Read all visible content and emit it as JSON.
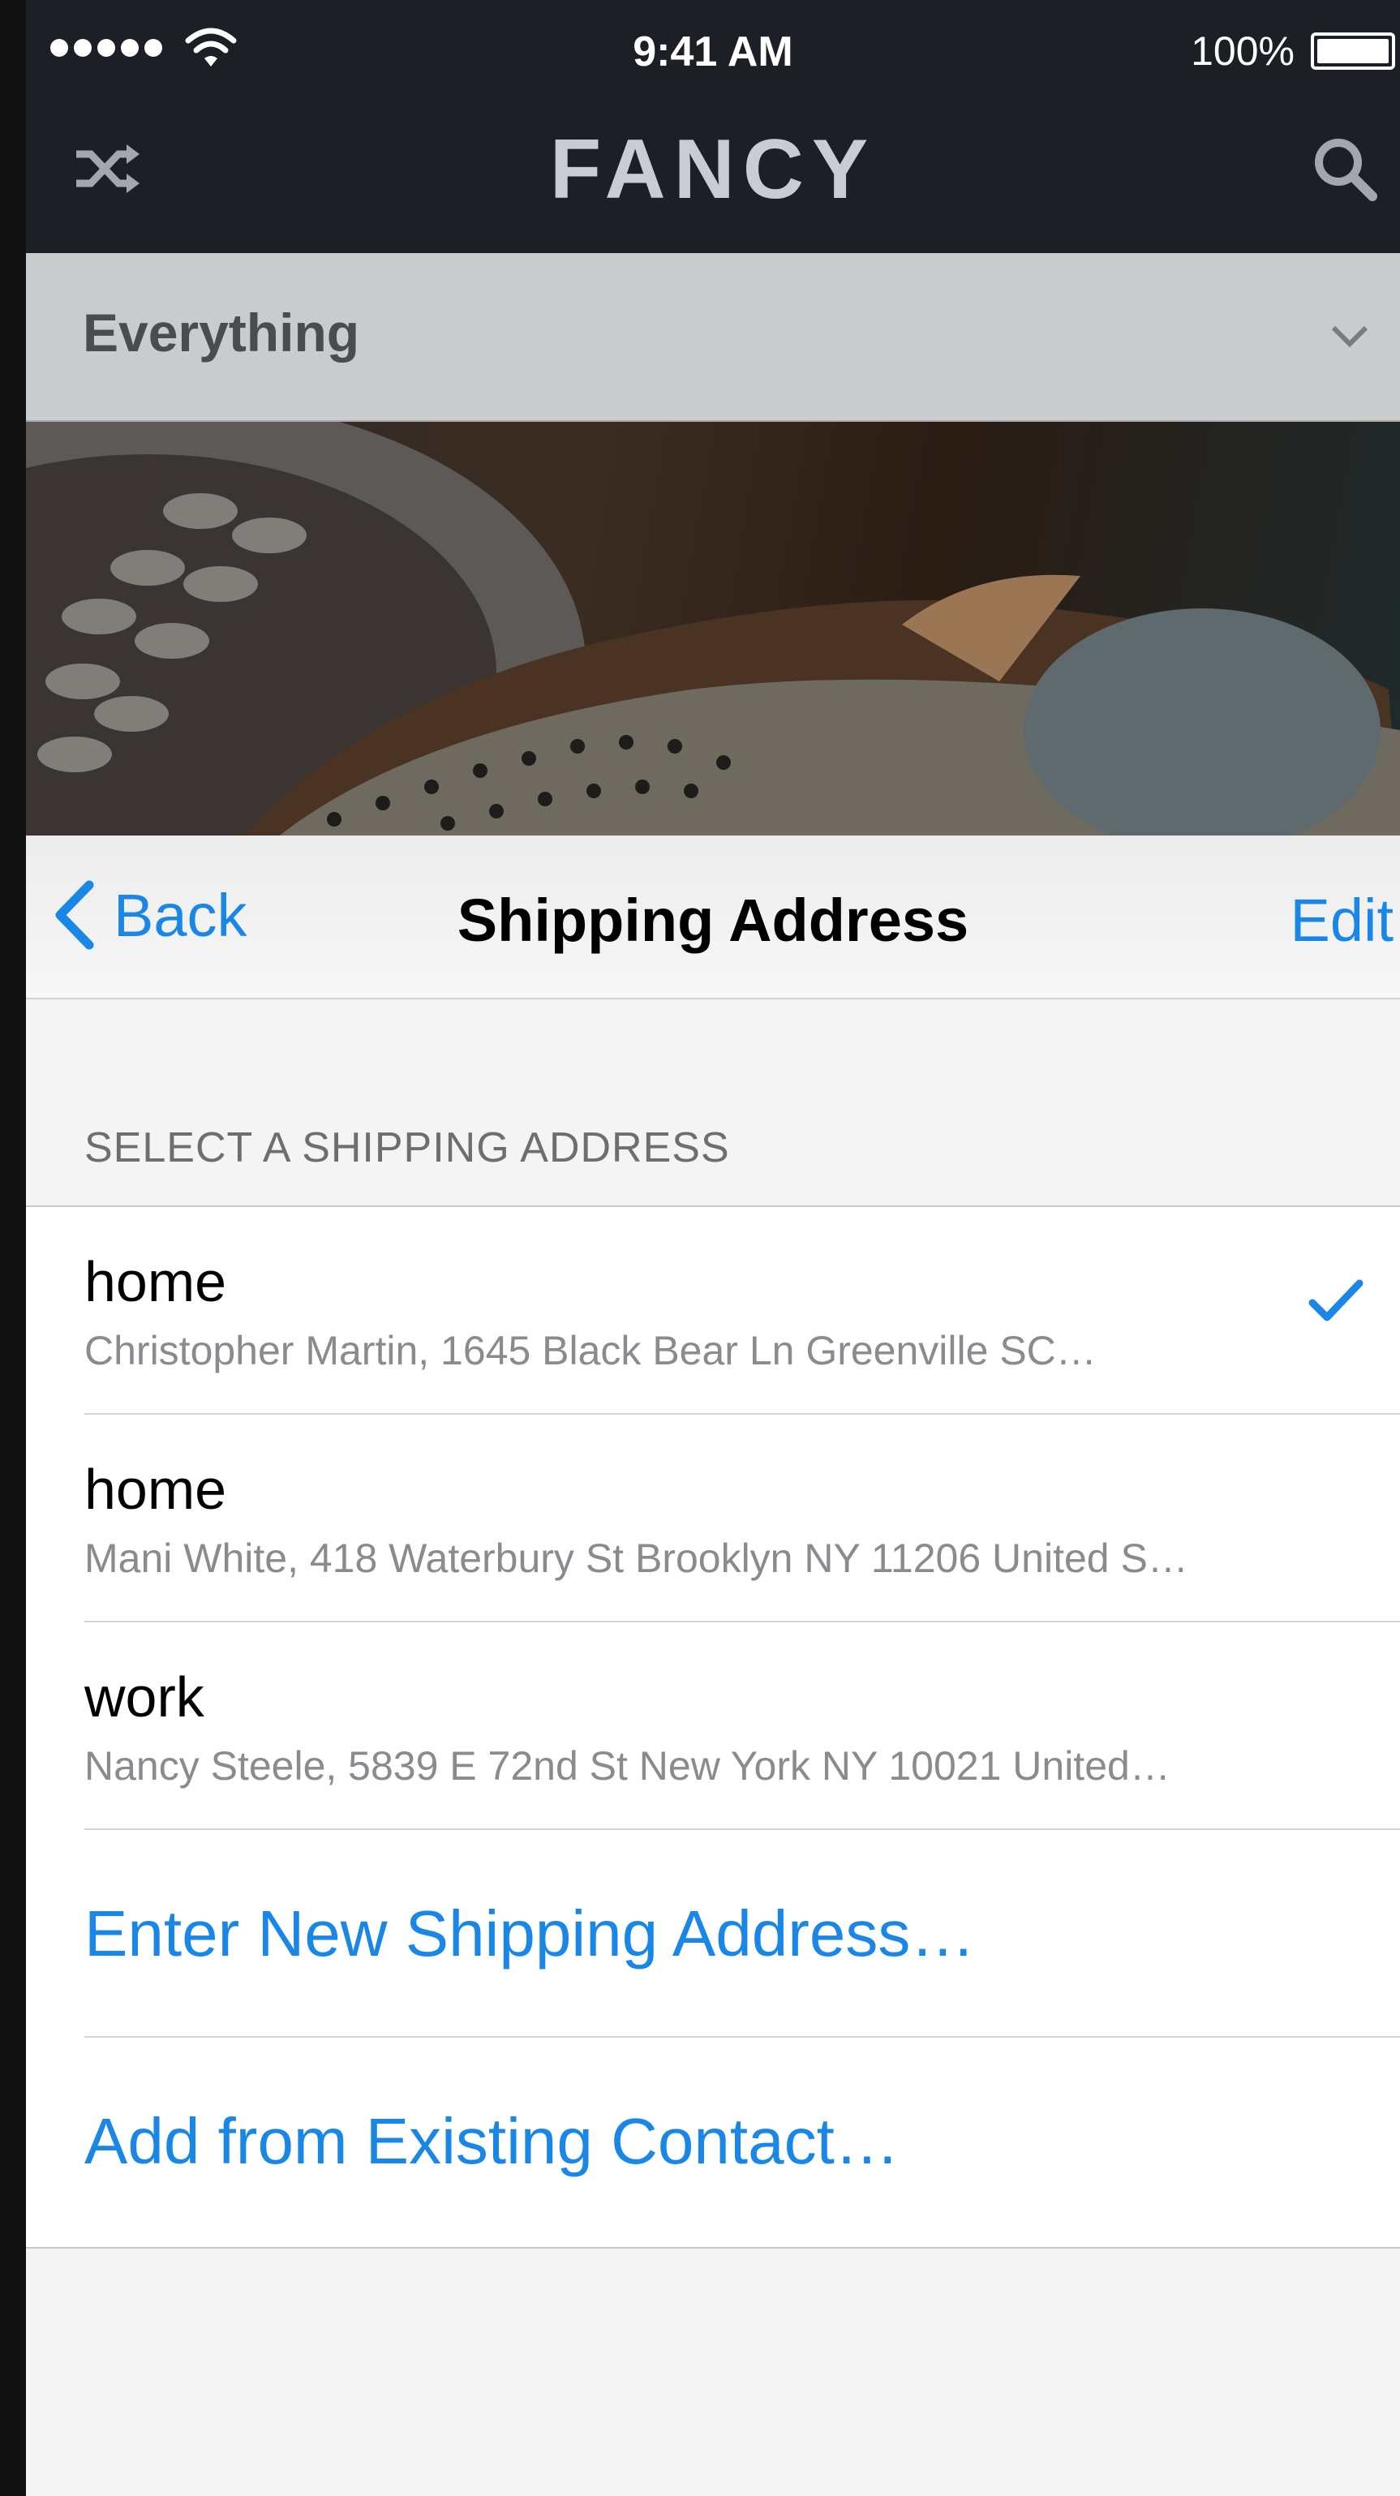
{
  "status_bar": {
    "time": "9:41 AM",
    "battery": "100%"
  },
  "app": {
    "brand": "FANCY"
  },
  "category": {
    "label": "Everything"
  },
  "nav": {
    "back_label": "Back",
    "title": "Shipping Address",
    "edit_label": "Edit"
  },
  "section": {
    "header": "SELECT A SHIPPING ADDRESS"
  },
  "addresses": [
    {
      "label": "home",
      "detail": "Christopher Martin, 1645 Black Bear Ln Greenville SC…",
      "selected": true
    },
    {
      "label": "home",
      "detail": "Mani White, 418 Waterbury St Brooklyn NY 11206 United S…",
      "selected": false
    },
    {
      "label": "work",
      "detail": "Nancy Steele, 5839 E 72nd St New York NY 10021 United…",
      "selected": false
    }
  ],
  "actions": {
    "new_address": "Enter New Shipping Address…",
    "from_contact": "Add from Existing Contact…"
  },
  "colors": {
    "accent": "#1a87e6",
    "header_bg": "#1c1f26"
  }
}
